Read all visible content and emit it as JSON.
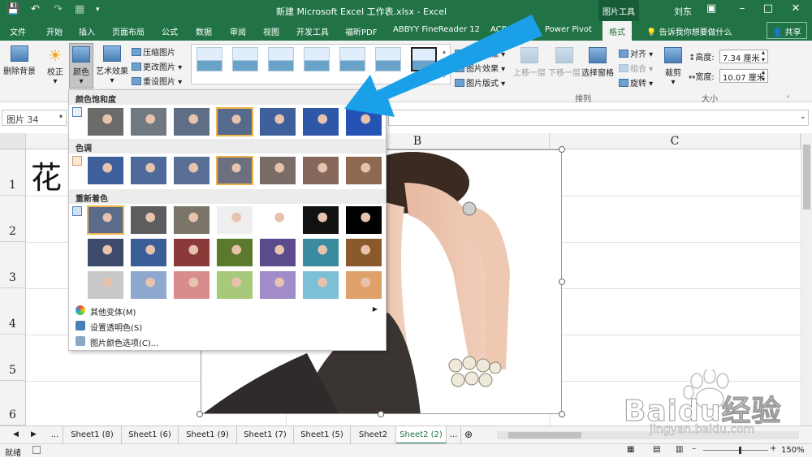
{
  "titlebar": {
    "title": "新建 Microsoft Excel 工作表.xlsx - Excel",
    "context_tab": "图片工具",
    "user": "刘东"
  },
  "tabs": [
    "文件",
    "开始",
    "插入",
    "页面布局",
    "公式",
    "数据",
    "审阅",
    "视图",
    "开发工具",
    "福昕PDF",
    "ABBYY FineReader 12",
    "ACROBAT",
    "Power Pivot",
    "格式"
  ],
  "tell_me": "告诉我你想要做什么",
  "share": "共享",
  "ribbon": {
    "remove_bg": "删除背景",
    "correct": "校正",
    "color": "颜色",
    "artistic": "艺术效果",
    "compress": "压缩图片",
    "change": "更改图片",
    "reset": "重设图片",
    "border": "图片边框",
    "effects": "图片效果",
    "layout": "图片版式",
    "bring_forward": "上移一层",
    "send_backward": "下移一层",
    "selection_pane": "选择窗格",
    "align": "对齐",
    "group": "组合",
    "rotate": "旋转",
    "arrange_group": "排列",
    "crop": "裁剪",
    "height_label": "高度:",
    "height": "7.34 厘米",
    "width_label": "宽度:",
    "width": "10.07 厘米",
    "size_group": "大小"
  },
  "namebox": "图片 34",
  "columns": [
    "B",
    "C"
  ],
  "rows": [
    "1",
    "2",
    "3",
    "4",
    "5",
    "6"
  ],
  "cell_a1": "花",
  "menu": {
    "saturation": "颜色饱和度",
    "tone": "色调",
    "recolor": "重新着色",
    "more_variants": "其他变体(M)",
    "set_transparent": "设置透明色(S)",
    "color_options": "图片颜色选项(C)..."
  },
  "sheets": [
    "...",
    "Sheet1 (8)",
    "Sheet1 (6)",
    "Sheet1 (9)",
    "Sheet1 (7)",
    "Sheet1 (5)",
    "Sheet2",
    "Sheet2 (2)",
    "..."
  ],
  "status": {
    "ready": "就绪",
    "zoom": "150%"
  },
  "watermark": {
    "brand": "Baidu经验",
    "url": "jingyan.baidu.com"
  },
  "colors": {
    "excel_green": "#217346",
    "arrow_blue": "#1aa0e8",
    "highlight": "#f0b44a"
  }
}
